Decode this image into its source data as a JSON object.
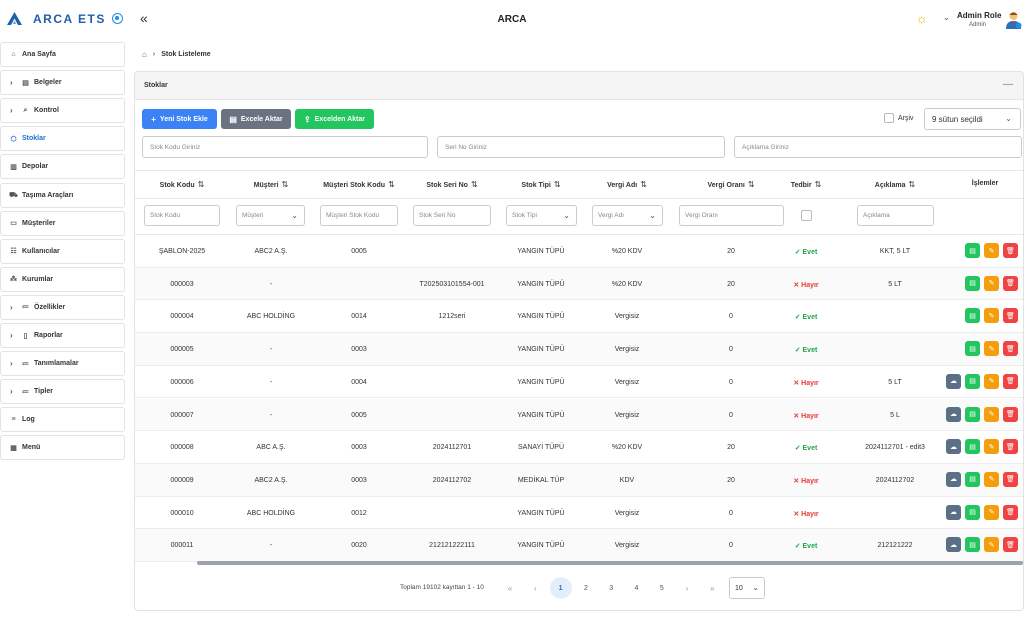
{
  "brand": {
    "name": "ARCA ETS"
  },
  "header": {
    "title": "ARCA",
    "user_name": "Admin Role",
    "user_role": "Admin"
  },
  "icons": {
    "logo": "arca-logo-icon",
    "radio": "radio-dot-icon",
    "collapse": "double-chevron-left-icon",
    "theme": "sun-icon",
    "user_menu": "chevron-down-icon",
    "avatar": "user-avatar-icon"
  },
  "sidebar": {
    "items": [
      {
        "label": "Ana Sayfa",
        "icon": "home-icon",
        "chevron": false,
        "active": false
      },
      {
        "label": "Belgeler",
        "icon": "document-icon",
        "chevron": true,
        "active": false
      },
      {
        "label": "Kontrol",
        "icon": "search-icon",
        "chevron": true,
        "active": false
      },
      {
        "label": "Stoklar",
        "icon": "box-icon",
        "chevron": false,
        "active": true
      },
      {
        "label": "Depolar",
        "icon": "warehouse-icon",
        "chevron": false,
        "active": false
      },
      {
        "label": "Taşıma Araçları",
        "icon": "truck-icon",
        "chevron": false,
        "active": false
      },
      {
        "label": "Müşteriler",
        "icon": "customers-icon",
        "chevron": false,
        "active": false
      },
      {
        "label": "Kullanıcılar",
        "icon": "users-icon",
        "chevron": false,
        "active": false
      },
      {
        "label": "Kurumlar",
        "icon": "organization-icon",
        "chevron": false,
        "active": false
      },
      {
        "label": "Özellikler",
        "icon": "list-icon",
        "chevron": true,
        "active": false
      },
      {
        "label": "Raporlar",
        "icon": "file-icon",
        "chevron": true,
        "active": false
      },
      {
        "label": "Tanımlamalar",
        "icon": "list-icon",
        "chevron": true,
        "active": false
      },
      {
        "label": "Tipler",
        "icon": "list-icon",
        "chevron": true,
        "active": false
      },
      {
        "label": "Log",
        "icon": "log-icon",
        "chevron": false,
        "active": false
      },
      {
        "label": "Menü",
        "icon": "menu-icon",
        "chevron": false,
        "active": false
      }
    ]
  },
  "breadcrumb": {
    "current": "Stok Listeleme"
  },
  "panel": {
    "title": "Stoklar",
    "buttons": {
      "add": "Yeni Stok Ekle",
      "export": "Excele Aktar",
      "import": "Excelden Aktar"
    },
    "archive_label": "Arşiv",
    "column_select": "9 sütun seçildi",
    "filters": {
      "stock_code": "Stok Kodu Giriniz",
      "serial": "Seri No Giriniz",
      "description": "Açıklama Giriniz"
    }
  },
  "table": {
    "columns": [
      "Stok Kodu",
      "Müşteri",
      "Müşteri Stok Kodu",
      "Stok Seri No",
      "Stok Tipi",
      "Vergi Adı",
      "Vergi Oranı",
      "Tedbir",
      "Açıklama",
      "İşlemler"
    ],
    "column_filters": {
      "stock_code": "Stok Kodu",
      "customer": "Müşteri",
      "customer_code": "Müşteri Stok Kodu",
      "serial": "Stok Seri No",
      "type": "Stok Tipi",
      "tax_name": "Vergi Adı",
      "tax_rate": "Vergi Oranı",
      "description": "Açıklama"
    },
    "rows": [
      {
        "code": "ŞABLON-2025",
        "customer": "ABC2 A.Ş.",
        "customer_code": "0005",
        "serial": "",
        "type": "YANGIN TÜPÜ",
        "tax_name": "%20 KDV",
        "tax_rate": "20",
        "tedbir": "Evet",
        "desc": "KKT, 5 LT",
        "cloud": false
      },
      {
        "code": "000003",
        "customer": "-",
        "customer_code": "",
        "serial": "T202503101554-001",
        "type": "YANGIN TÜPÜ",
        "tax_name": "%20 KDV",
        "tax_rate": "20",
        "tedbir": "Hayır",
        "desc": "5 LT",
        "cloud": false
      },
      {
        "code": "000004",
        "customer": "ABC HOLDİNG",
        "customer_code": "0014",
        "serial": "1212seri",
        "type": "YANGIN TÜPÜ",
        "tax_name": "Vergisiz",
        "tax_rate": "0",
        "tedbir": "Evet",
        "desc": "",
        "cloud": false
      },
      {
        "code": "000005",
        "customer": "-",
        "customer_code": "0003",
        "serial": "",
        "type": "YANGIN TÜPÜ",
        "tax_name": "Vergisiz",
        "tax_rate": "0",
        "tedbir": "Evet",
        "desc": "",
        "cloud": false
      },
      {
        "code": "000006",
        "customer": "-",
        "customer_code": "0004",
        "serial": "",
        "type": "YANGIN TÜPÜ",
        "tax_name": "Vergisiz",
        "tax_rate": "0",
        "tedbir": "Hayır",
        "desc": "5 LT",
        "cloud": true
      },
      {
        "code": "000007",
        "customer": "-",
        "customer_code": "0005",
        "serial": "",
        "type": "YANGIN TÜPÜ",
        "tax_name": "Vergisiz",
        "tax_rate": "0",
        "tedbir": "Hayır",
        "desc": "5 L",
        "cloud": true
      },
      {
        "code": "000008",
        "customer": "ABC A.Ş.",
        "customer_code": "0003",
        "serial": "2024112701",
        "type": "SANAYİ TÜPÜ",
        "tax_name": "%20 KDV",
        "tax_rate": "20",
        "tedbir": "Evet",
        "desc": "2024112701 - edit3",
        "cloud": true
      },
      {
        "code": "000009",
        "customer": "ABC2 A.Ş.",
        "customer_code": "0003",
        "serial": "2024112702",
        "type": "MEDİKAL TÜP",
        "tax_name": "KDV",
        "tax_rate": "20",
        "tedbir": "Hayır",
        "desc": "2024112702",
        "cloud": true
      },
      {
        "code": "000010",
        "customer": "ABC HOLDİNG",
        "customer_code": "0012",
        "serial": "",
        "type": "YANGIN TÜPÜ",
        "tax_name": "Vergisiz",
        "tax_rate": "0",
        "tedbir": "Hayır",
        "desc": "",
        "cloud": true
      },
      {
        "code": "000011",
        "customer": "-",
        "customer_code": "0020",
        "serial": "212121222111",
        "type": "YANGIN TÜPÜ",
        "tax_name": "Vergisiz",
        "tax_rate": "0",
        "tedbir": "Evet",
        "desc": "212121222",
        "cloud": true
      }
    ]
  },
  "pagination": {
    "info": "Toplam 19102 kayıttan 1 - 10",
    "first": "«",
    "prev": "‹",
    "next": "›",
    "last": "»",
    "pages": [
      "1",
      "2",
      "3",
      "4",
      "5"
    ],
    "current": "1",
    "per_page": "10"
  },
  "colors": {
    "accent": "#3b82f6",
    "success": "#22c55e",
    "danger": "#ef4444",
    "warning": "#f59e0b",
    "brand": "#1f5fa8"
  }
}
